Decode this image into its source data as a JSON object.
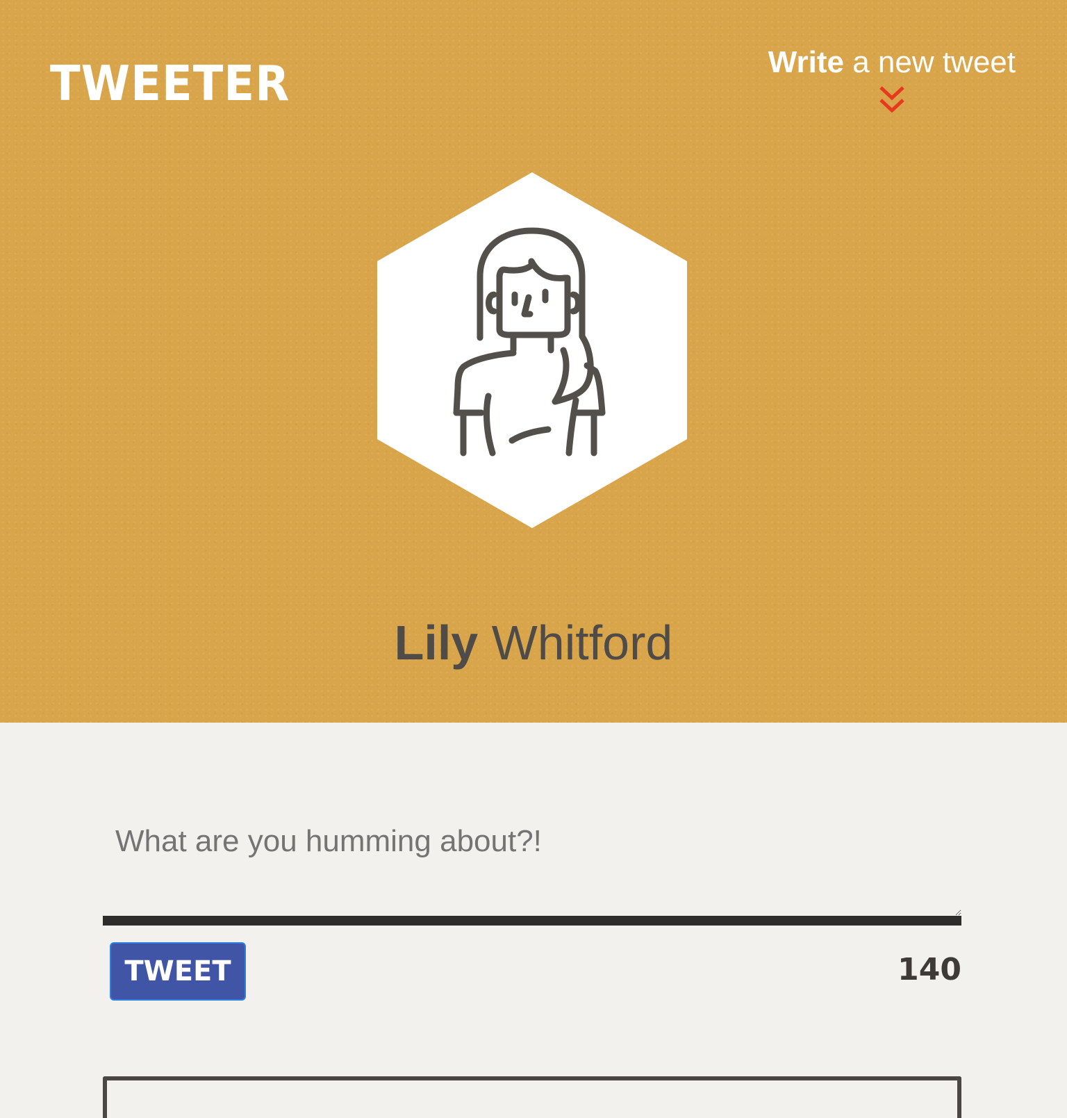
{
  "app": {
    "logo": "TWEETER"
  },
  "nav": {
    "compose_bold": "Write",
    "compose_rest": "a new tweet",
    "compose_icon": "double-chevron-down-icon",
    "accent_color": "#e8391f"
  },
  "profile": {
    "first_name": "Lily",
    "last_name": "Whitford",
    "avatar_icon": "woman-avatar-icon"
  },
  "composer": {
    "placeholder": "What are you humming about?!",
    "value": "",
    "button_label": "TWEET",
    "char_count": "140"
  },
  "colors": {
    "header_bg": "#d9a54b",
    "page_bg": "#f3f1ed",
    "button_bg": "#4055a6",
    "text_dark": "#4e4b48"
  }
}
